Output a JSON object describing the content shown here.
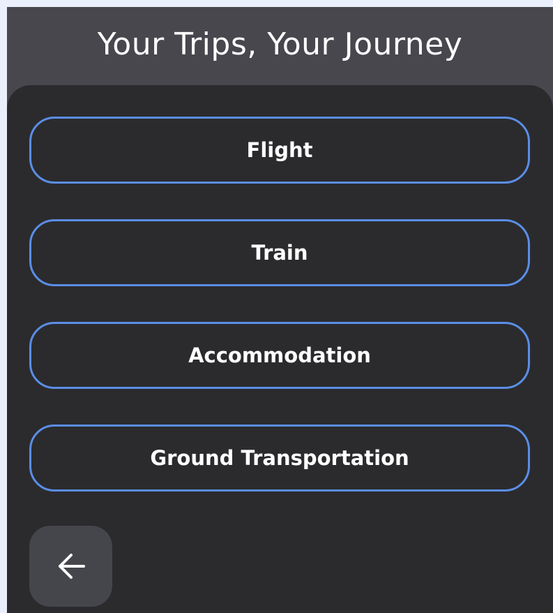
{
  "header": {
    "title": "Your Trips, Your Journey"
  },
  "options": [
    {
      "label": "Flight"
    },
    {
      "label": "Train"
    },
    {
      "label": "Accommodation"
    },
    {
      "label": "Ground Transportation"
    }
  ],
  "back_button": {
    "icon": "arrow-left-icon"
  },
  "colors": {
    "page_background": "#eaf0fb",
    "header_background": "#48474e",
    "panel_background": "#2b2b2e",
    "accent_border": "#5b8ee6",
    "back_button_background": "#45454c",
    "text": "#ffffff"
  }
}
